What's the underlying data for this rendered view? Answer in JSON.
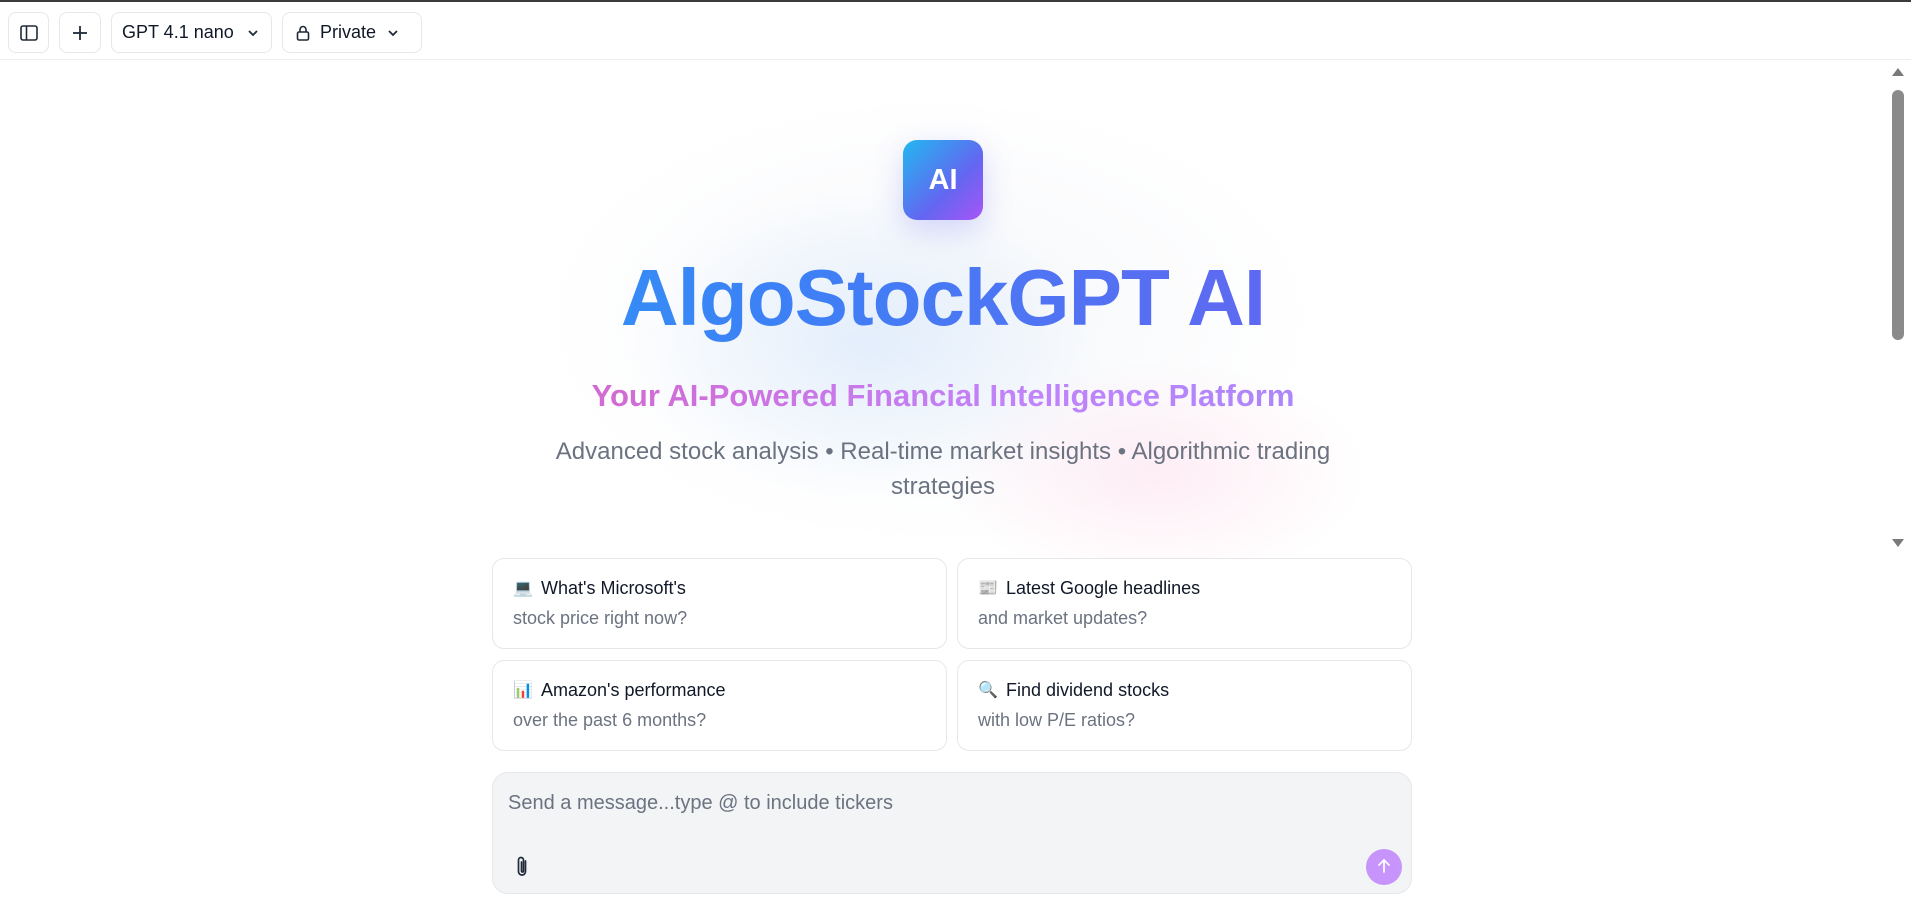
{
  "toolbar": {
    "model_label": "GPT 4.1 nano",
    "visibility_label": "Private"
  },
  "hero": {
    "logo_text": "AI",
    "title": "AlgoStockGPT AI",
    "subtitle": "Your AI-Powered Financial Intelligence Platform",
    "tagline": "Advanced stock analysis • Real-time market insights • Algorithmic trading strategies"
  },
  "suggestions": [
    {
      "emoji": "💻",
      "title": "What's Microsoft's",
      "subtitle": "stock price right now?"
    },
    {
      "emoji": "📰",
      "title": "Latest Google headlines",
      "subtitle": "and market updates?"
    },
    {
      "emoji": "📊",
      "title": "Amazon's performance",
      "subtitle": "over the past 6 months?"
    },
    {
      "emoji": "🔍",
      "title": "Find dividend stocks",
      "subtitle": "with low P/E ratios?"
    }
  ],
  "composer": {
    "placeholder": "Send a message...type @ to include tickers",
    "value": ""
  },
  "colors": {
    "accent_purple": "#c084fc",
    "title_gradient_start": "#22b8f0",
    "title_gradient_end": "#8b5cf6",
    "subtitle_gradient_start": "#ec4899",
    "subtitle_gradient_end": "#818cf8"
  },
  "icons": {
    "sidebar_toggle": "sidebar-toggle-icon",
    "new_chat": "plus-icon",
    "model_dropdown": "chevron-down-icon",
    "lock": "lock-icon",
    "attach": "paperclip-icon",
    "send": "arrow-up-icon"
  }
}
